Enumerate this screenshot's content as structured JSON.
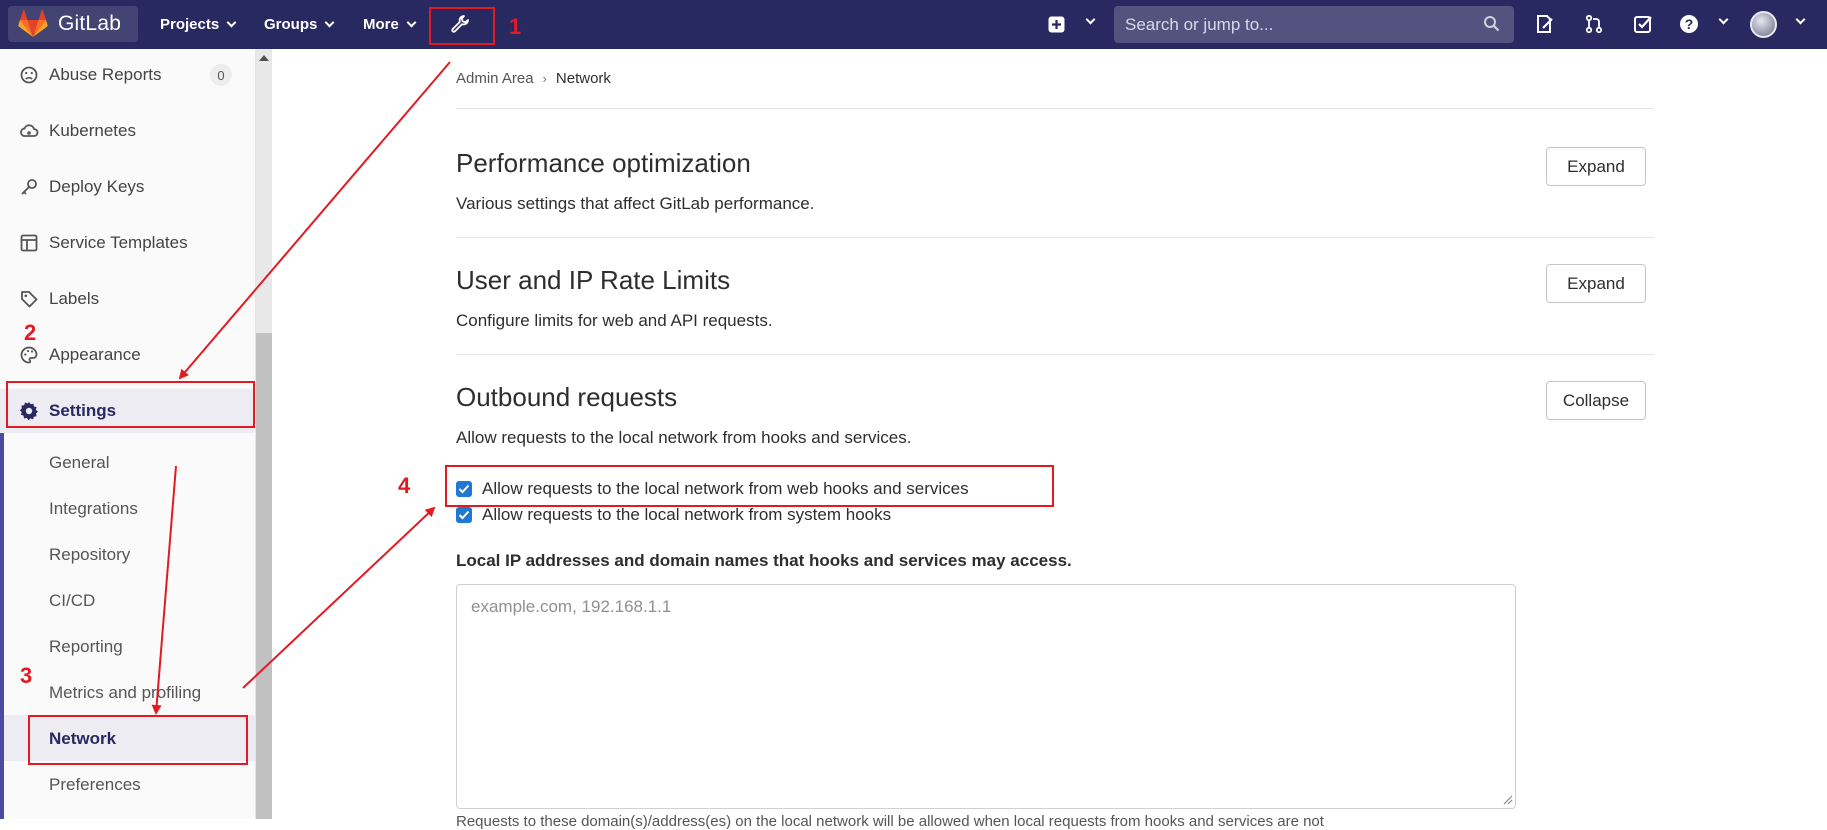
{
  "navbar": {
    "brand": "GitLab",
    "links": [
      "Projects",
      "Groups",
      "More"
    ],
    "search_placeholder": "Search or jump to...",
    "icons": [
      "admin-wrench-icon",
      "plus-square-icon",
      "issues-icon",
      "merge-request-icon",
      "todo-icon",
      "help-icon",
      "avatar"
    ]
  },
  "sidebar": {
    "items": [
      {
        "label": "Abuse Reports",
        "icon": "frown-face-icon",
        "count": "0"
      },
      {
        "label": "Kubernetes",
        "icon": "cloud-gear-icon"
      },
      {
        "label": "Deploy Keys",
        "icon": "key-icon"
      },
      {
        "label": "Service Templates",
        "icon": "template-icon"
      },
      {
        "label": "Labels",
        "icon": "tag-icon"
      },
      {
        "label": "Appearance",
        "icon": "palette-icon"
      },
      {
        "label": "Settings",
        "icon": "gear-icon"
      }
    ],
    "settings_subitems": [
      "General",
      "Integrations",
      "Repository",
      "CI/CD",
      "Reporting",
      "Metrics and profiling",
      "Network",
      "Preferences"
    ]
  },
  "breadcrumb": {
    "parent": "Admin Area",
    "current": "Network"
  },
  "sections": [
    {
      "title": "Performance optimization",
      "description": "Various settings that affect GitLab performance.",
      "button": "Expand"
    },
    {
      "title": "User and IP Rate Limits",
      "description": "Configure limits for web and API requests.",
      "button": "Expand"
    },
    {
      "title": "Outbound requests",
      "description": "Allow requests to the local network from hooks and services.",
      "button": "Collapse"
    }
  ],
  "outbound": {
    "checkbox_webhooks": "Allow requests to the local network from web hooks and services",
    "checkbox_system_hooks": "Allow requests to the local network from system hooks",
    "field_label": "Local IP addresses and domain names that hooks and services may access.",
    "field_placeholder": "example.com, 192.168.1.1",
    "field_value": "",
    "help_text": "Requests to these domain(s)/address(es) on the local network will be allowed when local requests from hooks and services are not"
  },
  "annotations": [
    "1",
    "2",
    "3",
    "4"
  ],
  "colors": {
    "navbar": "#292961",
    "annotation": "#e21b23",
    "checkbox": "#1f78d1"
  }
}
